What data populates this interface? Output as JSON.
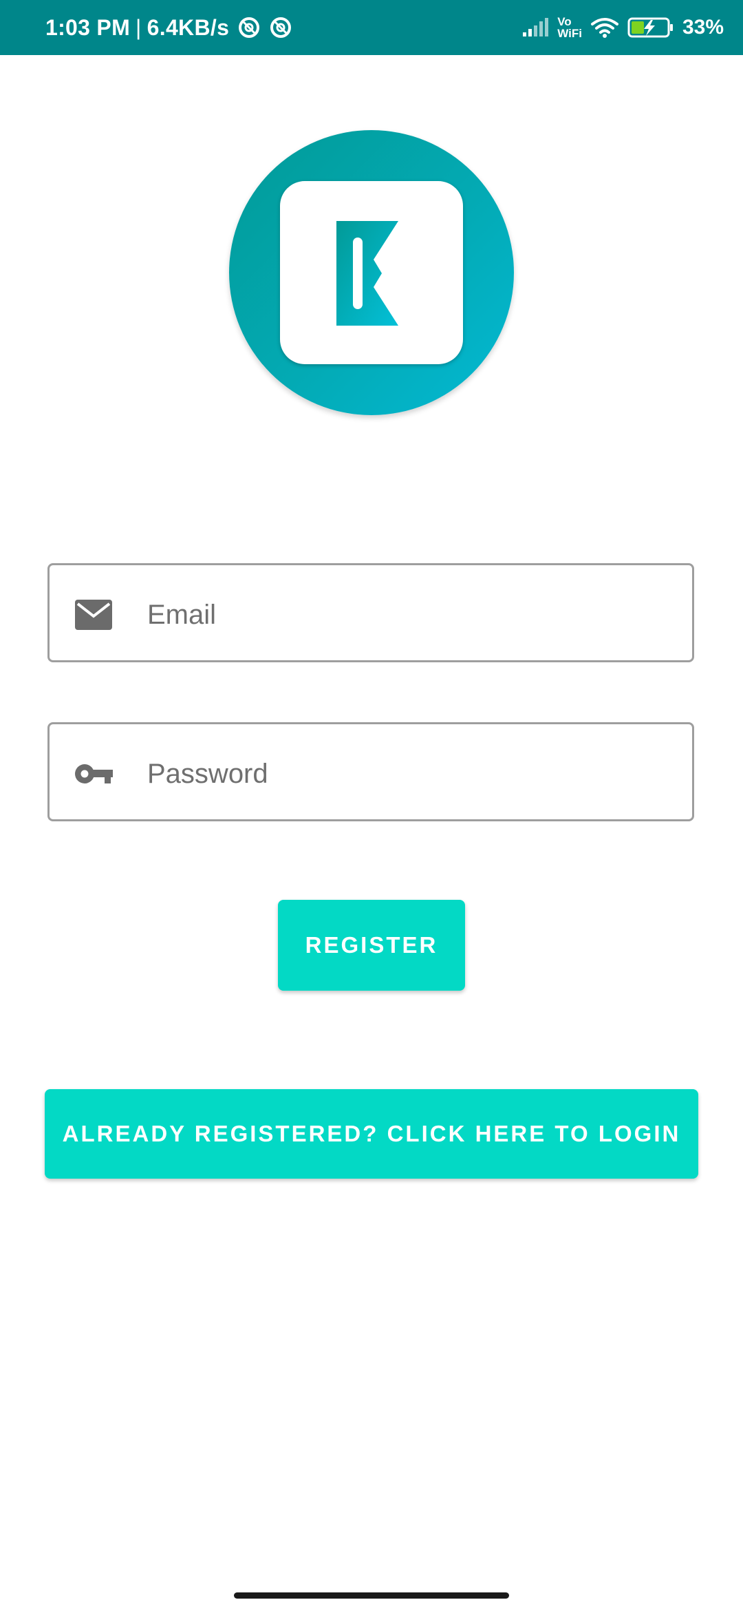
{
  "status_bar": {
    "time": "1:03 PM",
    "separator": "|",
    "network_speed": "6.4KB/s",
    "vowifi_top": "Vo",
    "vowifi_bottom": "WiFi",
    "battery_percent": "33%"
  },
  "form": {
    "email": {
      "placeholder": "Email",
      "value": "",
      "icon": "email-icon"
    },
    "password": {
      "placeholder": "Password",
      "value": "",
      "icon": "key-icon"
    }
  },
  "buttons": {
    "register_label": "REGISTER",
    "login_label": "ALREADY REGISTERED? CLICK HERE TO LOGIN"
  },
  "colors": {
    "status_bar": "#00868a",
    "accent": "#03d9c5",
    "logo_gradient_start": "#029a97",
    "logo_gradient_end": "#03b9d4",
    "field_border": "#9e9e9e",
    "icon_gray": "#6b6b6b"
  }
}
